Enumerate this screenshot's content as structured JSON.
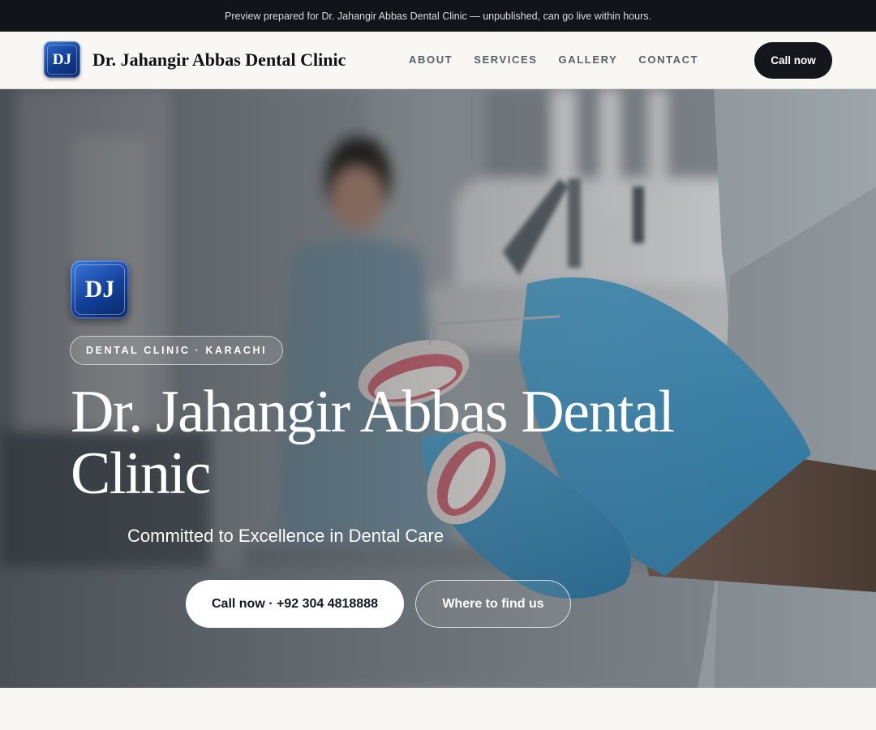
{
  "preview_bar": {
    "text": "Preview prepared for Dr. Jahangir Abbas Dental Clinic — unpublished, can go live within hours."
  },
  "header": {
    "logo_initials": "DJ",
    "brand_name": "Dr. Jahangir Abbas Dental Clinic",
    "nav": [
      {
        "label": "ABOUT"
      },
      {
        "label": "SERVICES"
      },
      {
        "label": "GALLERY"
      },
      {
        "label": "CONTACT"
      }
    ],
    "cta_label": "Call now"
  },
  "hero": {
    "logo_initials": "DJ",
    "eyebrow": "DENTAL CLINIC · KARACHI",
    "title": "Dr. Jahangir Abbas Dental Clinic",
    "tagline": "Committed to Excellence in Dental Care",
    "primary_cta": "Call now · +92 304 4818888",
    "secondary_cta": "Where to find us"
  },
  "colors": {
    "preview_bar_bg": "#111419",
    "header_bg": "#f8f7f4",
    "dark_button": "#14161b",
    "logo_blue": "#123f97",
    "glove_blue": "#4e9fc9"
  }
}
